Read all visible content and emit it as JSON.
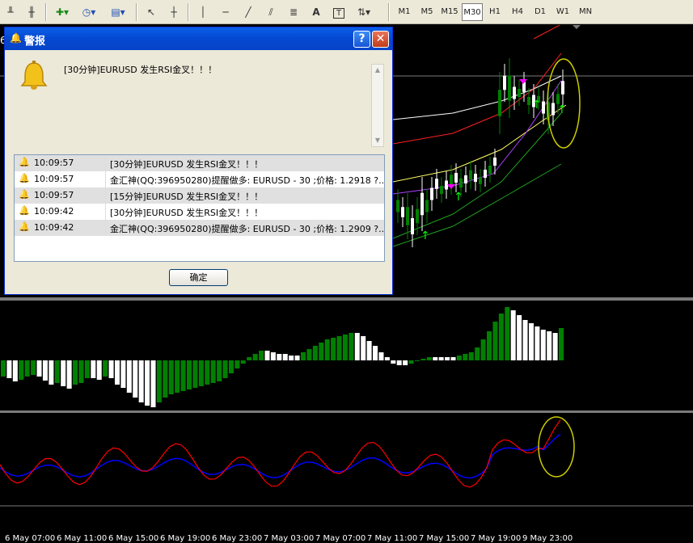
{
  "toolbar": {
    "timeframes": [
      "M1",
      "M5",
      "M15",
      "M30",
      "H1",
      "H4",
      "D1",
      "W1",
      "MN"
    ],
    "active_timeframe": "M30",
    "text_tool": "A",
    "text_label_tool": "T"
  },
  "chart": {
    "price_edge_label": "6",
    "x_axis_labels": [
      "6 May 07:00",
      "6 May 11:00",
      "6 May 15:00",
      "6 May 19:00",
      "6 May 23:00",
      "7 May 03:00",
      "7 May 07:00",
      "7 May 11:00",
      "7 May 15:00",
      "7 May 19:00",
      "9 May 23:00"
    ],
    "colors": {
      "background": "#000000",
      "bull_candle": "#008000",
      "bear_candle": "#ffffff",
      "rsi_line": "#ff0000",
      "signal_line": "#0000ff",
      "annotation_ring": "#cccc00"
    }
  },
  "dialog": {
    "title": "警报",
    "message": "[30分钟]EURUSD 发生RSI金叉！！！",
    "ok_label": "确定",
    "alerts": [
      {
        "time": "10:09:57",
        "message": "[30分钟]EURUSD 发生RSI金叉！！！"
      },
      {
        "time": "10:09:57",
        "message": "金汇神(QQ:396950280)提醒做多: EURUSD - 30 ;价格: 1.2918  ?.."
      },
      {
        "time": "10:09:57",
        "message": "[15分钟]EURUSD 发生RSI金叉！！！"
      },
      {
        "time": "10:09:42",
        "message": "[30分钟]EURUSD 发生RSI金叉！！！"
      },
      {
        "time": "10:09:42",
        "message": "金汇神(QQ:396950280)提醒做多: EURUSD - 30 ;价格: 1.2909  ?.."
      }
    ]
  }
}
